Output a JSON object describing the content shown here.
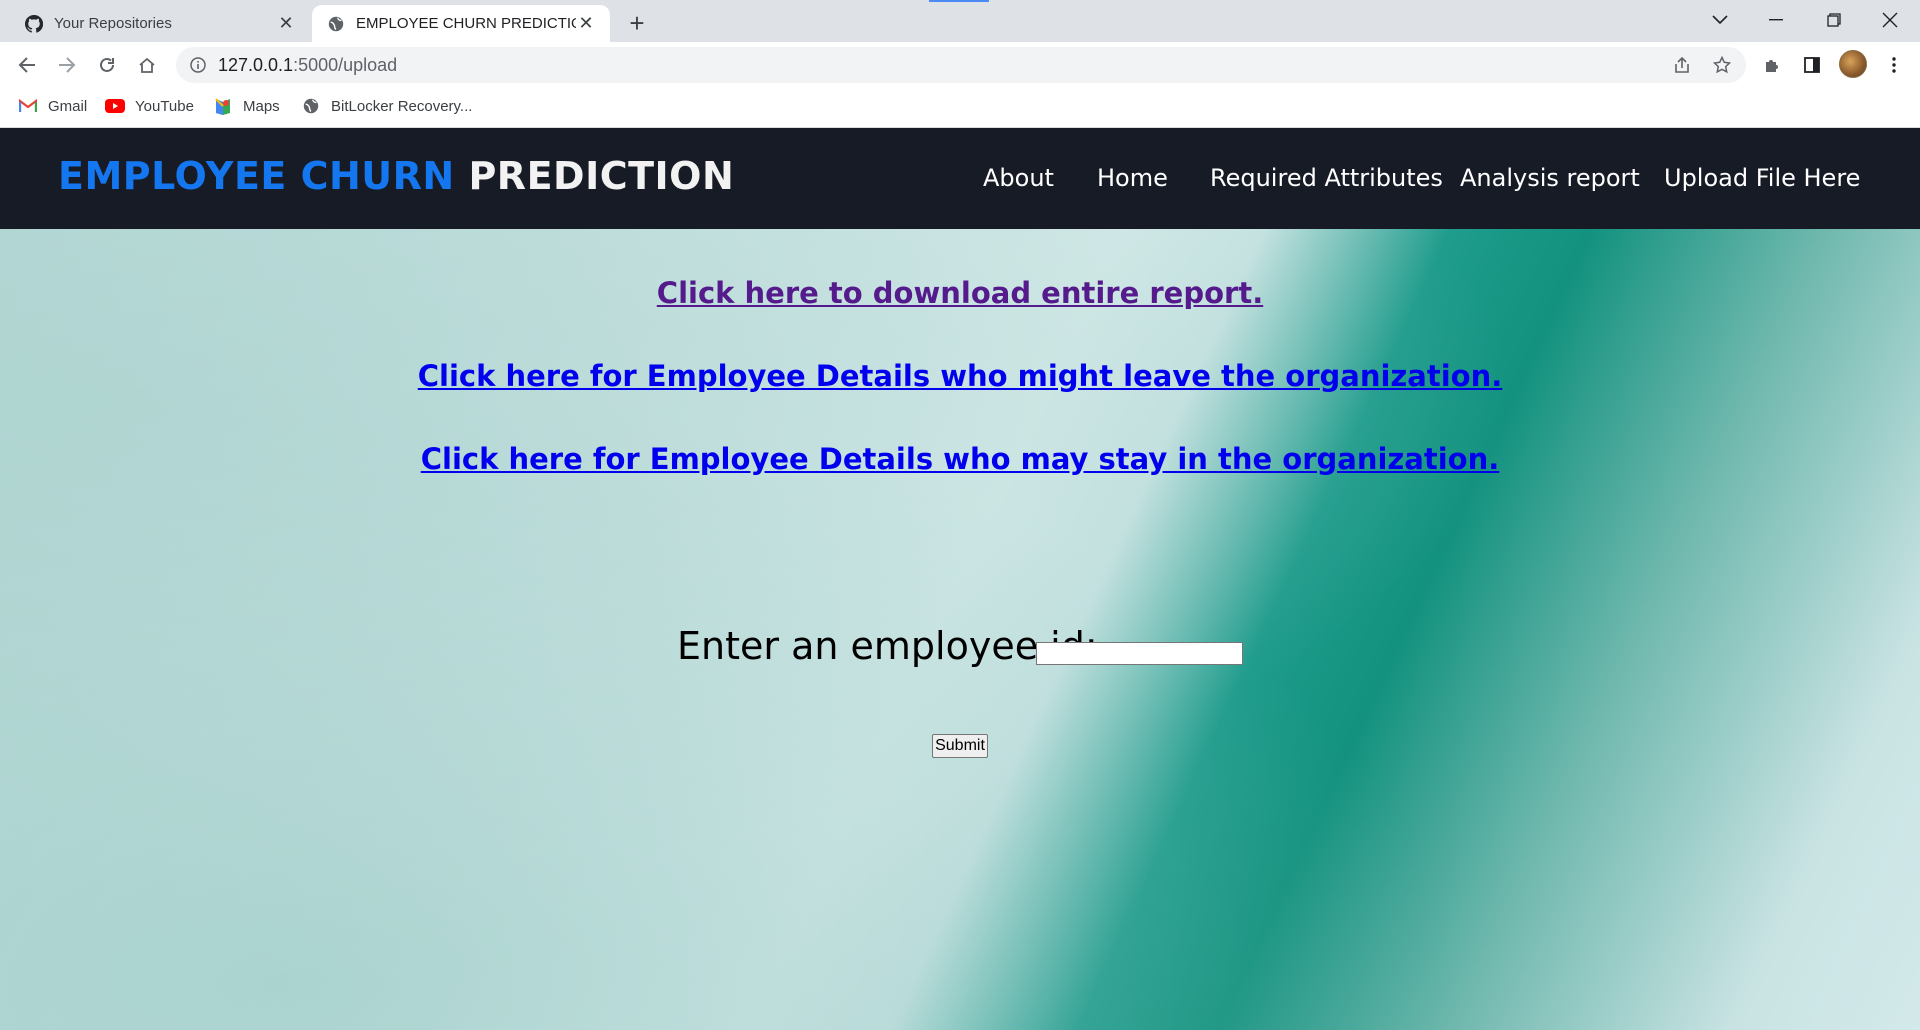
{
  "browser": {
    "tabs": [
      {
        "title": "Your Repositories",
        "icon": "github-icon",
        "active": false
      },
      {
        "title": "EMPLOYEE CHURN PREDICTION",
        "icon": "globe-icon",
        "active": true
      }
    ],
    "url_host": "127.0.0.1",
    "url_path": ":5000/upload",
    "bookmarks": [
      {
        "label": "Gmail",
        "icon": "gmail-icon"
      },
      {
        "label": "YouTube",
        "icon": "youtube-icon"
      },
      {
        "label": "Maps",
        "icon": "maps-icon"
      },
      {
        "label": "BitLocker Recovery...",
        "icon": "globe-icon"
      }
    ]
  },
  "site": {
    "brand_part1": "EMPLOYEE CHURN",
    "brand_part2": "PREDICTION",
    "nav": [
      "About",
      "Home",
      "Required Attributes",
      "Analysis report",
      "Upload File Here"
    ]
  },
  "main": {
    "links": [
      "Click here to download entire report.",
      "Click here for Employee Details who might leave the organization.",
      "Click here for Employee Details who may stay in the organization."
    ],
    "employee_label": "Enter an employee id:",
    "employee_input_value": "",
    "submit_label": "Submit"
  },
  "colors": {
    "header_bg": "#161b26",
    "brand_blue": "#1577f0",
    "link_blue": "#0000ee",
    "link_visited": "#551a8b"
  }
}
